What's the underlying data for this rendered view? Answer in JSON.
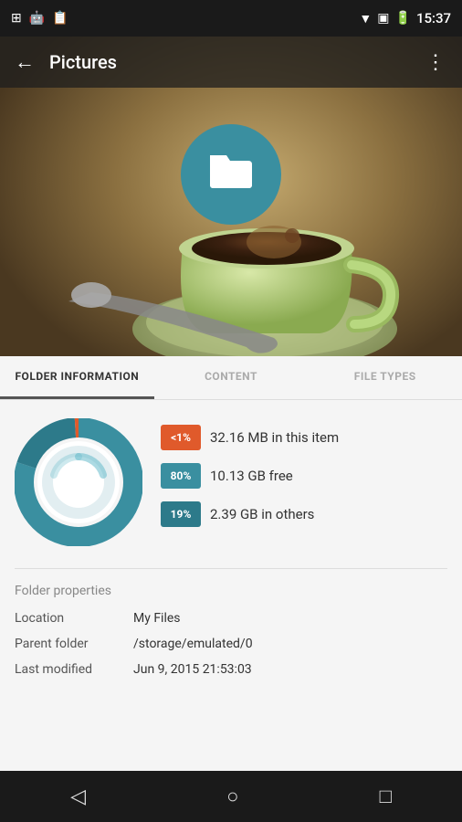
{
  "statusBar": {
    "time": "15:37",
    "icons": [
      "grid-icon",
      "android-icon",
      "clipboard-icon"
    ]
  },
  "toolbar": {
    "title": "Pictures",
    "backLabel": "←",
    "menuLabel": "⋮"
  },
  "tabs": [
    {
      "id": "folder-info",
      "label": "FOLDER INFORMATION",
      "active": true
    },
    {
      "id": "content",
      "label": "CONTENT",
      "active": false
    },
    {
      "id": "file-types",
      "label": "FILE TYPES",
      "active": false
    }
  ],
  "stats": [
    {
      "badge": "<1%",
      "text": "32.16 MB in this item",
      "color": "orange"
    },
    {
      "badge": "80%",
      "text": "10.13 GB free",
      "color": "teal"
    },
    {
      "badge": "19%",
      "text": "2.39 GB in others",
      "color": "teal-dark"
    }
  ],
  "donut": {
    "segments": [
      {
        "label": "<1%",
        "value": 1,
        "color": "#e05a2b"
      },
      {
        "label": "80%",
        "value": 80,
        "color": "#3a8fa0"
      },
      {
        "label": "19%",
        "value": 19,
        "color": "#2d7a8a"
      }
    ]
  },
  "folderProperties": {
    "sectionTitle": "Folder properties",
    "rows": [
      {
        "label": "Location",
        "value": "My Files"
      },
      {
        "label": "Parent folder",
        "value": "/storage/emulated/0"
      },
      {
        "label": "Last modified",
        "value": "Jun 9, 2015 21:53:03"
      }
    ]
  },
  "bottomNav": {
    "back": "◁",
    "home": "○",
    "recent": "□"
  }
}
